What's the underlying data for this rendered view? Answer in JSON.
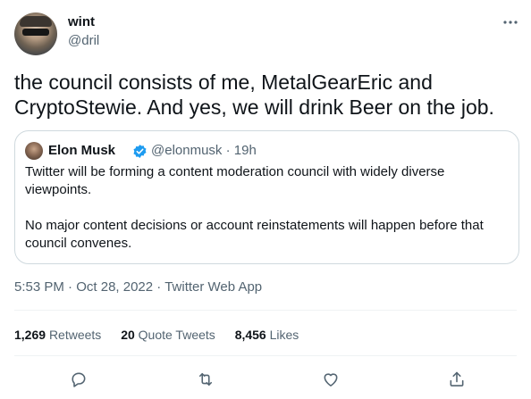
{
  "author": {
    "name": "wint",
    "handle": "@dril",
    "more_icon": "more-horizontal-icon"
  },
  "tweet": {
    "text": "the council consists of me, MetalGearEric and CryptoStewie. And yes, we will drink Beer on the job."
  },
  "quoted_tweet": {
    "name": "Elon Musk",
    "verified": true,
    "meta": "@elonmusk · 19h",
    "paragraph1": "Twitter will be forming a content moderation council with widely diverse viewpoints.",
    "paragraph2": "No major content decisions or account reinstatements will happen before that council convenes."
  },
  "timestamp": {
    "time": "5:53 PM",
    "separator": " · ",
    "date": "Oct 28, 2022",
    "source": "Twitter Web App"
  },
  "stats": {
    "retweets_count": "1,269",
    "retweets_label": "Retweets",
    "quotes_count": "20",
    "quotes_label": "Quote Tweets",
    "likes_count": "8,456",
    "likes_label": "Likes"
  },
  "actions": [
    "reply-icon",
    "retweet-icon",
    "like-icon",
    "share-icon"
  ],
  "colors": {
    "text": "#0f1419",
    "secondary": "#536471",
    "border": "#cfd9de",
    "divider": "#eff3f4",
    "verified": "#1d9bf0"
  }
}
